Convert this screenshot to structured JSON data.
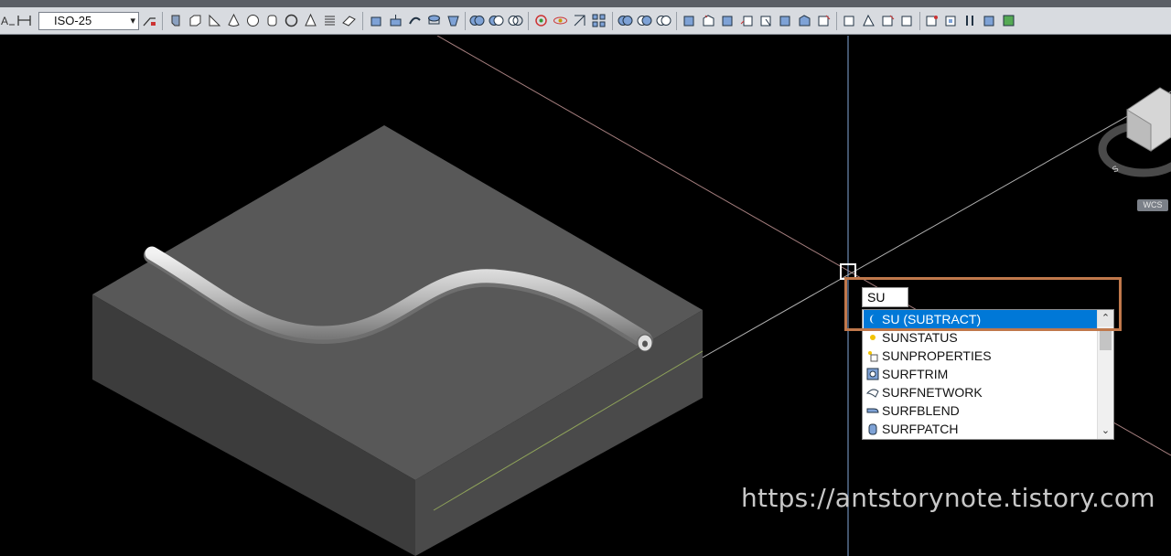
{
  "toolbar": {
    "dim_style_value": "ISO-25",
    "dim_style_arrow": "▾"
  },
  "command_line": {
    "input_text": "SU",
    "autocomplete": [
      {
        "label": "SU (SUBTRACT)",
        "icon": "subtract-icon",
        "selected": true
      },
      {
        "label": "SUNSTATUS",
        "icon": "sun-icon",
        "selected": false
      },
      {
        "label": "SUNPROPERTIES",
        "icon": "sun-properties-icon",
        "selected": false
      },
      {
        "label": "SURFTRIM",
        "icon": "surface-trim-icon",
        "selected": false
      },
      {
        "label": "SURFNETWORK",
        "icon": "surface-network-icon",
        "selected": false
      },
      {
        "label": "SURFBLEND",
        "icon": "surface-blend-icon",
        "selected": false
      },
      {
        "label": "SURFPATCH",
        "icon": "surface-patch-icon",
        "selected": false
      }
    ],
    "scroll_up": "⌃",
    "scroll_down": "⌄"
  },
  "viewcube": {
    "wcs_label": "WCS"
  },
  "watermark": "https://antstorynote.tistory.com",
  "colors": {
    "highlight": "#c0784b",
    "selection": "#0078d7",
    "block_top": "#565656",
    "block_left": "#3e3e3e",
    "block_right": "#4a4a4a"
  }
}
